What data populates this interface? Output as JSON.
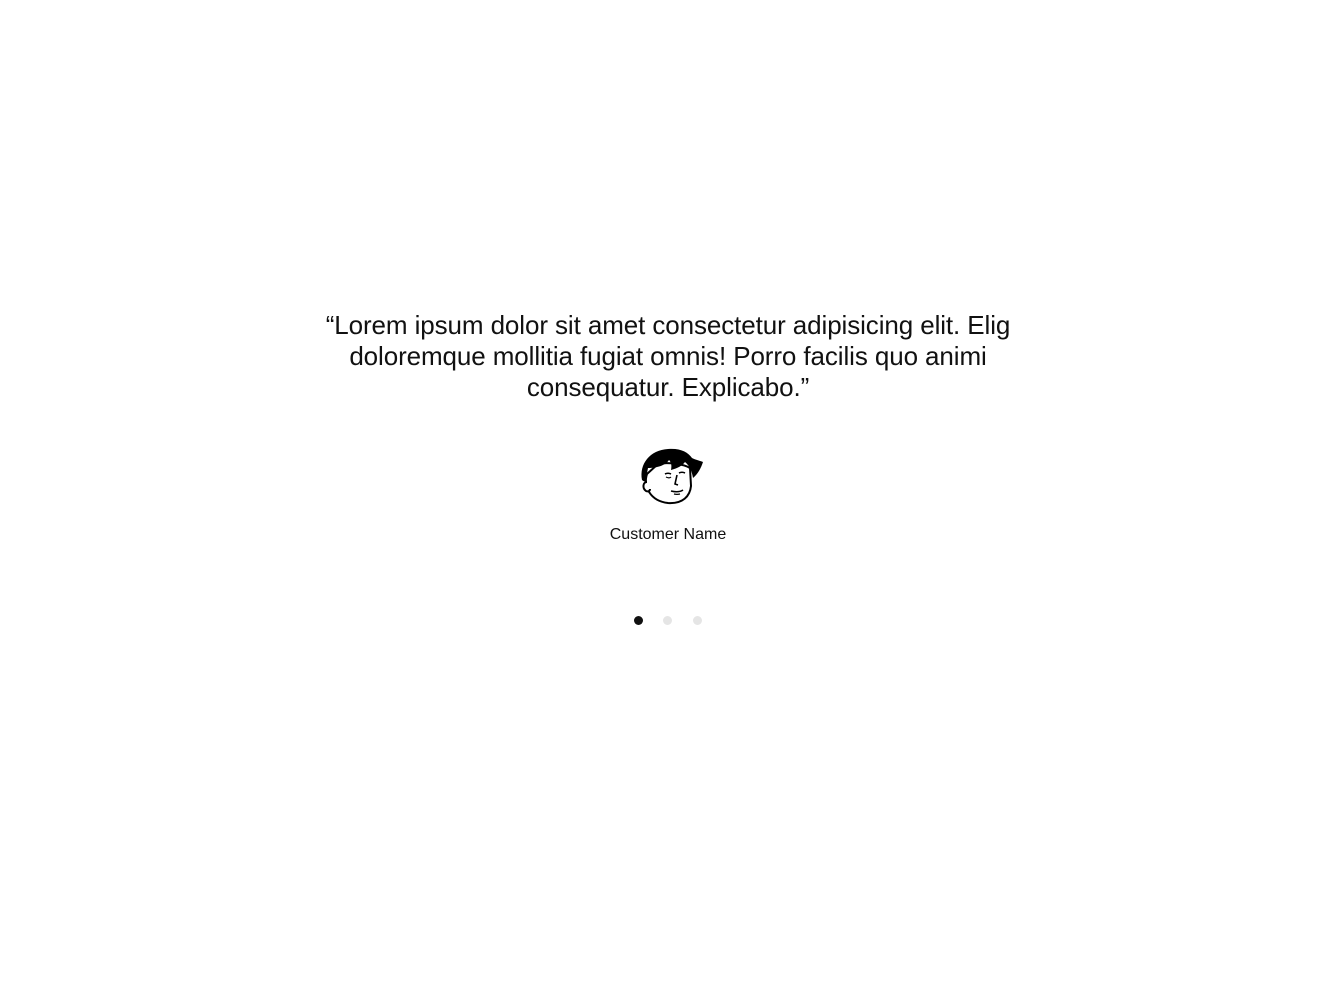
{
  "testimonial": {
    "quote": "“Lorem ipsum dolor sit amet consectetur adipisicing elit. Elig doloremque mollitia fugiat omnis! Porro facilis quo animi consequatur. Explicabo.”",
    "customer_name": "Customer Name",
    "avatar_icon": "customer-avatar-illustration"
  },
  "carousel": {
    "slide_count": 3,
    "active_slide": 1
  },
  "colors": {
    "text": "#111111",
    "dot_active": "#111111",
    "dot_inactive": "#e5e5e5",
    "background": "#ffffff"
  }
}
